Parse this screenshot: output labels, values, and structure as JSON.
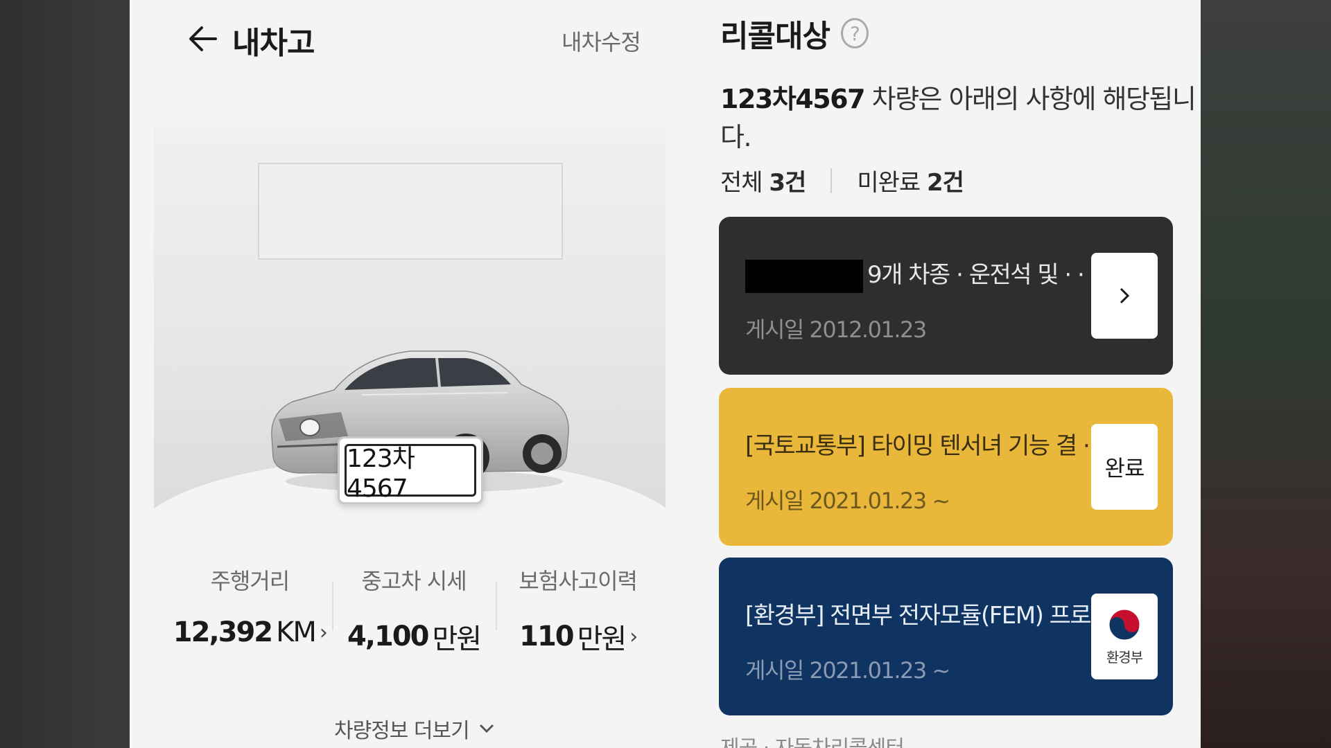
{
  "header": {
    "title": "내차고",
    "edit_label": "내차수정"
  },
  "vehicle": {
    "plate": "123차4567"
  },
  "stats": [
    {
      "label": "주행거리",
      "value": "12,392",
      "unit": "KM",
      "has_arrow": true
    },
    {
      "label": "중고차 시세",
      "value": "4,100",
      "unit": "만원",
      "has_arrow": false
    },
    {
      "label": "보험사고이력",
      "value": "110",
      "unit": "만원",
      "has_arrow": true
    }
  ],
  "more_info_label": "차량정보 더보기",
  "recall": {
    "title": "리콜대상",
    "help_glyph": "?",
    "desc_plate": "123차4567",
    "desc_rest": " 차량은 아래의 사항에 해당됩니다.",
    "total_label": "전체",
    "total_count": "3건",
    "pending_label": "미완료",
    "pending_count": "2건",
    "cards": [
      {
        "title": "9개 차종 · 운전석 및 · · ·",
        "date": "게시일 2012.01.23",
        "action": "›",
        "color": "#2e2e2e"
      },
      {
        "title": "[국토교통부] 타이밍 텐서녀 기능 결 · · ·",
        "date": "게시일 2021.01.23 ~",
        "action": "완료",
        "color": "#e9b83a"
      },
      {
        "title": "[환경부] 전면부 전자모듈(FEM) 프로 · · ·",
        "date": "게시일 2021.01.23 ~",
        "action": "환경부",
        "color": "#0f3461"
      }
    ],
    "provider": "제공 · 자동차리콜센터"
  },
  "icons": {
    "back": "arrow-left-icon",
    "dropdown": "chevron-down-icon",
    "next": "chevron-right-icon",
    "ministry": "korea-emblem-icon"
  }
}
